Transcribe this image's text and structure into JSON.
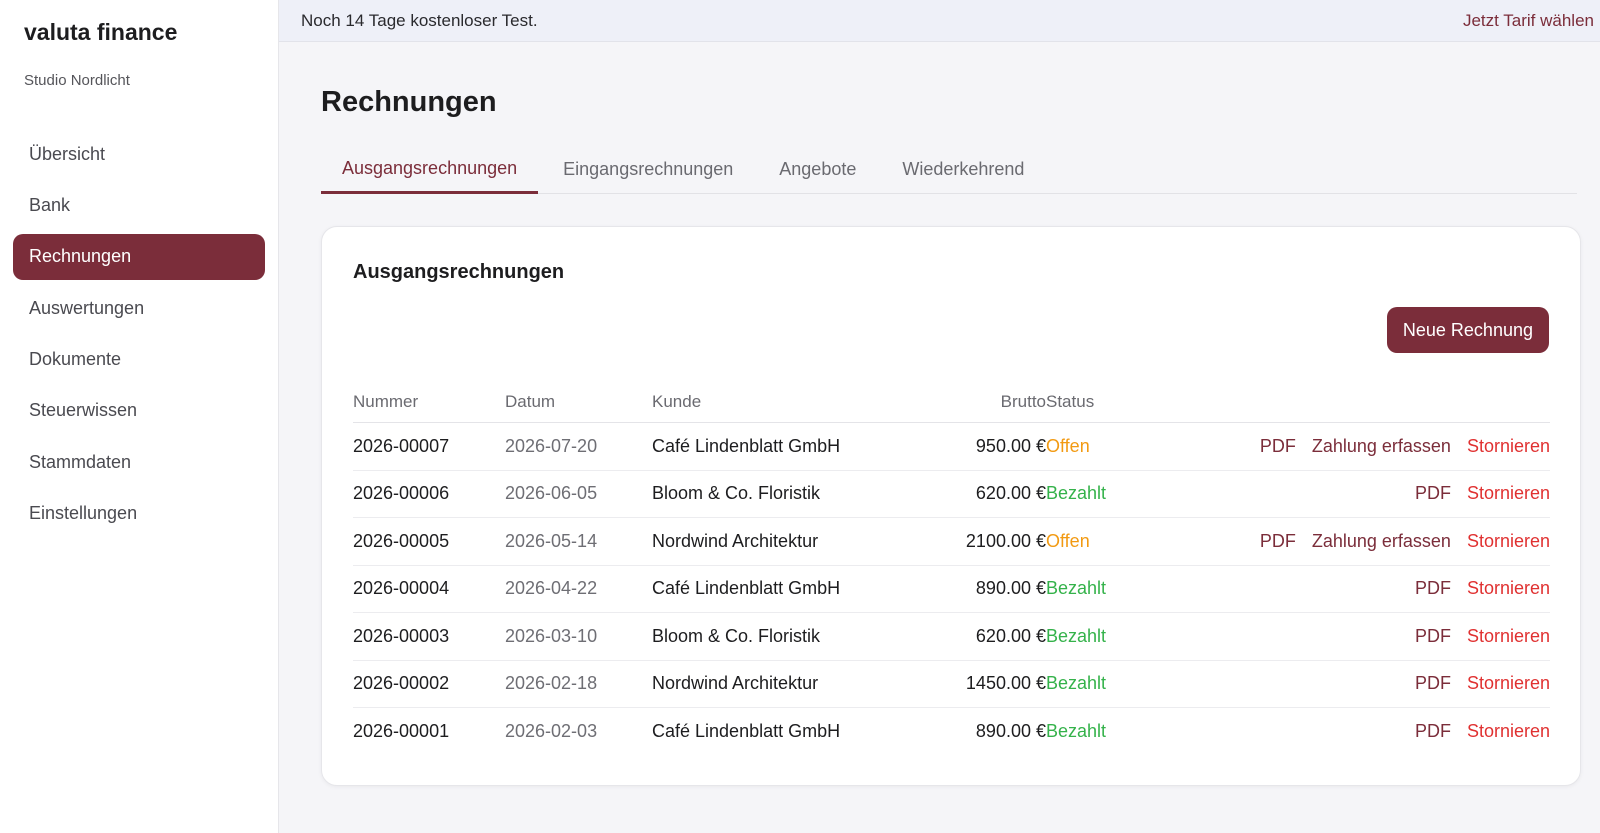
{
  "sidebar": {
    "brand": "valuta finance",
    "workspace": "Studio Nordlicht",
    "items": [
      {
        "label": "Übersicht",
        "active": false
      },
      {
        "label": "Bank",
        "active": false
      },
      {
        "label": "Rechnungen",
        "active": true
      },
      {
        "label": "Auswertungen",
        "active": false
      },
      {
        "label": "Dokumente",
        "active": false
      },
      {
        "label": "Steuerwissen",
        "active": false
      },
      {
        "label": "Stammdaten",
        "active": false
      },
      {
        "label": "Einstellungen",
        "active": false
      }
    ]
  },
  "trial": {
    "text": "Noch 14 Tage kostenloser Test.",
    "link": "Jetzt Tarif wählen"
  },
  "page": {
    "title": "Rechnungen",
    "tabs": [
      {
        "label": "Ausgangsrechnungen",
        "active": true
      },
      {
        "label": "Eingangsrechnungen",
        "active": false
      },
      {
        "label": "Angebote",
        "active": false
      },
      {
        "label": "Wiederkehrend",
        "active": false
      }
    ]
  },
  "card": {
    "title": "Ausgangsrechnungen",
    "new_button": "Neue Rechnung",
    "columns": {
      "number": "Nummer",
      "date": "Datum",
      "customer": "Kunde",
      "gross": "Brutto",
      "status": "Status"
    },
    "actions": {
      "pdf": "PDF",
      "payment": "Zahlung erfassen",
      "cancel": "Stornieren"
    },
    "rows": [
      {
        "number": "2026-00007",
        "date": "2026-07-20",
        "customer": "Café Lindenblatt GmbH",
        "gross": "950.00 €",
        "status": "Offen",
        "open": true
      },
      {
        "number": "2026-00006",
        "date": "2026-06-05",
        "customer": "Bloom & Co. Floristik",
        "gross": "620.00 €",
        "status": "Bezahlt",
        "open": false
      },
      {
        "number": "2026-00005",
        "date": "2026-05-14",
        "customer": "Nordwind Architektur",
        "gross": "2100.00 €",
        "status": "Offen",
        "open": true
      },
      {
        "number": "2026-00004",
        "date": "2026-04-22",
        "customer": "Café Lindenblatt GmbH",
        "gross": "890.00 €",
        "status": "Bezahlt",
        "open": false
      },
      {
        "number": "2026-00003",
        "date": "2026-03-10",
        "customer": "Bloom & Co. Floristik",
        "gross": "620.00 €",
        "status": "Bezahlt",
        "open": false
      },
      {
        "number": "2026-00002",
        "date": "2026-02-18",
        "customer": "Nordwind Architektur",
        "gross": "1450.00 €",
        "status": "Bezahlt",
        "open": false
      },
      {
        "number": "2026-00001",
        "date": "2026-02-03",
        "customer": "Café Lindenblatt GmbH",
        "gross": "890.00 €",
        "status": "Bezahlt",
        "open": false
      }
    ]
  },
  "colors": {
    "accent": "#7b2d3a",
    "status_open": "#f29a12",
    "status_paid": "#34b24a",
    "cancel": "#e03131"
  }
}
